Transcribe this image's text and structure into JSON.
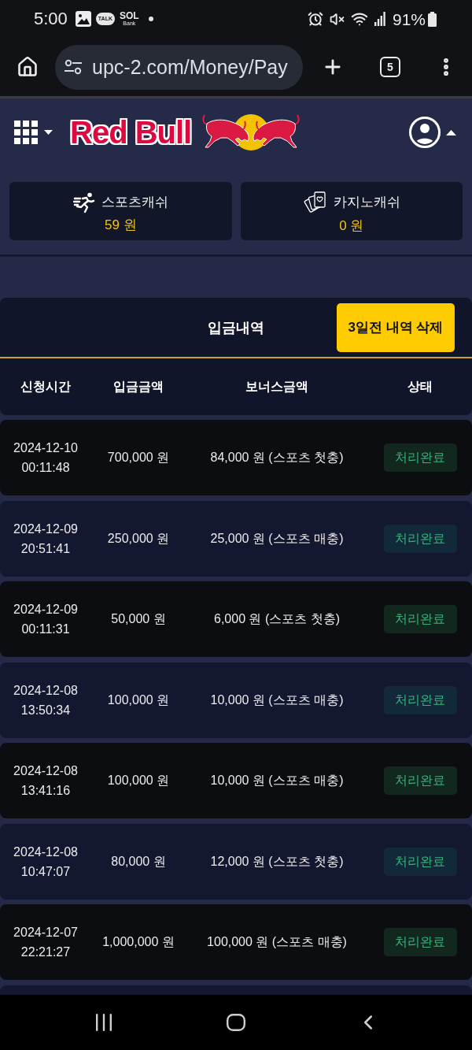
{
  "status_bar": {
    "time": "5:00",
    "chat_badge": "TALK",
    "bank_logo": {
      "name": "SOL",
      "caption": "Bank"
    },
    "battery": "91%"
  },
  "browser": {
    "url": "upc-2.com/Money/Pay",
    "tab_count": "5"
  },
  "header": {
    "logo": "Red Bull"
  },
  "wallets": [
    {
      "kind": "sports",
      "label": "스포츠캐쉬",
      "amount": "59 원"
    },
    {
      "kind": "casino",
      "label": "카지노캐쉬",
      "amount": "0 원"
    }
  ],
  "deposits": {
    "title": "입금내역",
    "delete_button": "3일전 내역 삭제",
    "columns": [
      "신청시간",
      "입금금액",
      "보너스금액",
      "상태"
    ],
    "rows": [
      {
        "requested_at": "2024-12-10 00:11:48",
        "amount": "700,000 원",
        "bonus": "84,000 원 (스포츠 첫충)",
        "status": "처리완료"
      },
      {
        "requested_at": "2024-12-09 20:51:41",
        "amount": "250,000 원",
        "bonus": "25,000 원 (스포츠 매충)",
        "status": "처리완료"
      },
      {
        "requested_at": "2024-12-09 00:11:31",
        "amount": "50,000 원",
        "bonus": "6,000 원 (스포츠 첫충)",
        "status": "처리완료"
      },
      {
        "requested_at": "2024-12-08 13:50:34",
        "amount": "100,000 원",
        "bonus": "10,000 원 (스포츠 매충)",
        "status": "처리완료"
      },
      {
        "requested_at": "2024-12-08 13:41:16",
        "amount": "100,000 원",
        "bonus": "10,000 원 (스포츠 매충)",
        "status": "처리완료"
      },
      {
        "requested_at": "2024-12-08 10:47:07",
        "amount": "80,000 원",
        "bonus": "12,000 원 (스포츠 첫충)",
        "status": "처리완료"
      },
      {
        "requested_at": "2024-12-07 22:21:27",
        "amount": "1,000,000 원",
        "bonus": "100,000 원 (스포츠 매충)",
        "status": "처리완료"
      }
    ]
  }
}
